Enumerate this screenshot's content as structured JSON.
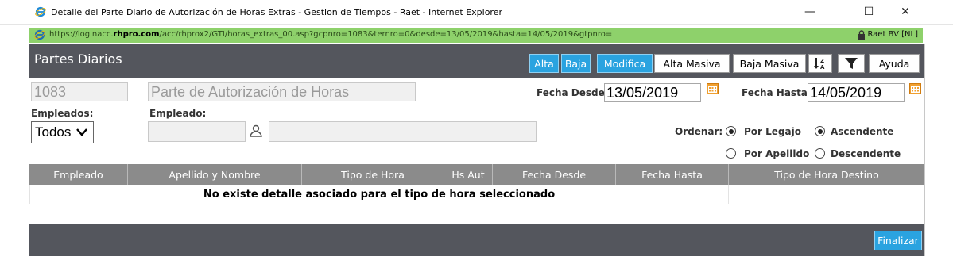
{
  "window": {
    "title": "Detalle del Parte Diario de Autorización de Horas Extras - Gestion de Tiempos - Raet - Internet Explorer",
    "minimize_glyph": "—",
    "maximize_glyph": "☐",
    "close_glyph": "✕"
  },
  "address": {
    "url_prefix": "https://loginacc.",
    "url_domain": "rhpro.com",
    "url_rest": "/acc/rhprox2/GTI/horas_extras_00.asp?gcpnro=1083&ternro=0&desde=13/05/2019&hasta=14/05/2019&gtpnro=",
    "cert": "Raet BV [NL]",
    "bar_color": "#8ed16b"
  },
  "header": {
    "title": "Partes Diarios",
    "buttons": {
      "alta": "Alta",
      "baja": "Baja",
      "modifica": "Modifica",
      "alta_masiva": "Alta Masiva",
      "baja_masiva": "Baja Masiva",
      "ayuda": "Ayuda"
    },
    "icons": [
      "sort-az-icon",
      "filter-icon"
    ]
  },
  "form": {
    "code": "1083",
    "description": "Parte de Autorización de Horas",
    "fecha_desde_label": "Fecha Desde:",
    "fecha_desde": "13/05/2019",
    "fecha_hasta_label": "Fecha Hasta:",
    "fecha_hasta": "14/05/2019",
    "empleados_label": "Empleados:",
    "empleados_value": "Todos",
    "empleado_label": "Empleado:",
    "empleado_code": "",
    "empleado_name": "",
    "ordenar_label": "Ordenar:",
    "order_by": [
      {
        "label": "Por Legajo",
        "checked": true
      },
      {
        "label": "Por Apellido",
        "checked": false
      }
    ],
    "direction": [
      {
        "label": "Ascendente",
        "checked": true
      },
      {
        "label": "Descendente",
        "checked": false
      }
    ]
  },
  "grid": {
    "columns": [
      "Empleado",
      "Apellido y Nombre",
      "Tipo de Hora",
      "Hs Aut",
      "Fecha Desde",
      "Fecha Hasta",
      "Tipo de Hora Destino"
    ],
    "empty_message": "No existe detalle asociado para el tipo de hora seleccionado",
    "header_color": "#8b8b8b"
  },
  "footer": {
    "finalizar": "Finalizar"
  },
  "colors": {
    "accent": "#2aa3e0",
    "bar": "#54565d",
    "calendar": "#f0a030"
  }
}
